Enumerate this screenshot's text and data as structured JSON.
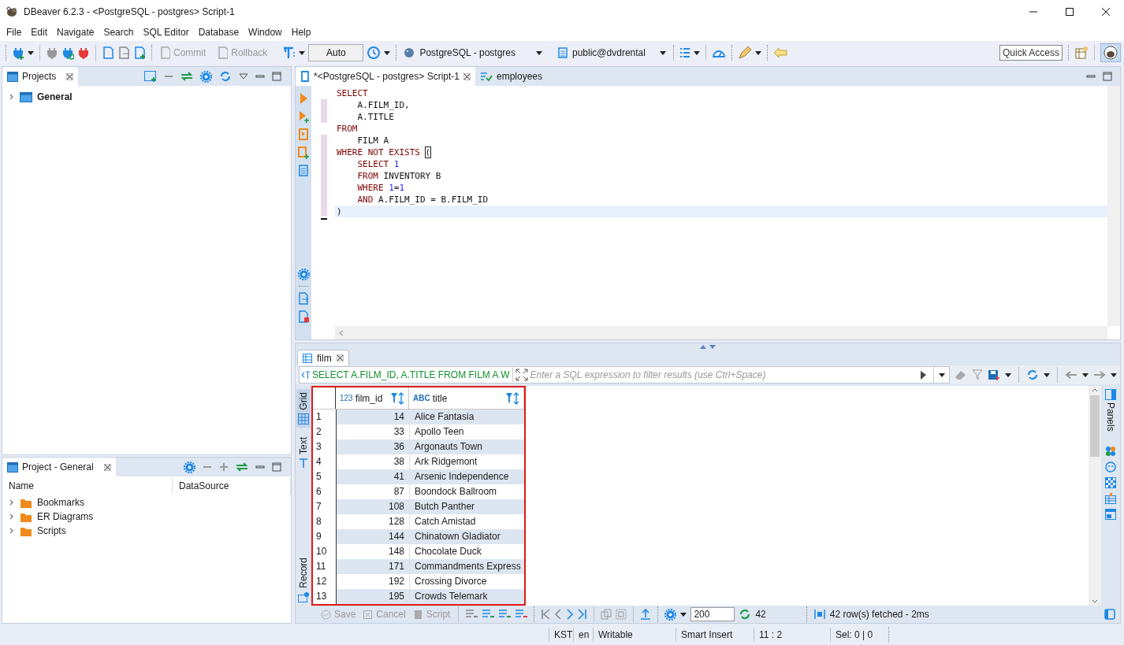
{
  "window": {
    "title": "DBeaver 6.2.3 - <PostgreSQL - postgres> Script-1"
  },
  "menu": [
    "File",
    "Edit",
    "Navigate",
    "Search",
    "SQL Editor",
    "Database",
    "Window",
    "Help"
  ],
  "toolbar": {
    "commit": {
      "label": "Commit",
      "disabled": true
    },
    "rollback": {
      "label": "Rollback",
      "disabled": true
    },
    "transaction_mode": "Auto",
    "datasource": "PostgreSQL - postgres",
    "schema": "public@dvdrental",
    "quick_access": "Quick Access"
  },
  "projects_panel": {
    "title": "Projects",
    "tree": [
      {
        "label": "General",
        "expanded": false
      }
    ]
  },
  "project_panel": {
    "title": "Project - General",
    "columns": [
      "Name",
      "DataSource"
    ],
    "tree": [
      {
        "label": "Bookmarks",
        "expanded": false
      },
      {
        "label": "ER Diagrams",
        "expanded": false
      },
      {
        "label": "Scripts",
        "expanded": false
      }
    ]
  },
  "editor": {
    "tabs": [
      {
        "label": "*<PostgreSQL - postgres> Script-1",
        "selected": true
      },
      {
        "label": "employees",
        "selected": false
      }
    ],
    "lines": [
      {
        "current": false,
        "tokens": [
          {
            "kind": "keyword",
            "text": "SELECT"
          }
        ]
      },
      {
        "current": false,
        "tokens": [
          {
            "kind": "plain",
            "text": "    A.FILM_ID,"
          }
        ]
      },
      {
        "current": false,
        "tokens": [
          {
            "kind": "plain",
            "text": "    A.TITLE"
          }
        ]
      },
      {
        "current": false,
        "tokens": [
          {
            "kind": "keyword",
            "text": "FROM"
          }
        ]
      },
      {
        "current": false,
        "tokens": [
          {
            "kind": "plain",
            "text": "    FILM A"
          }
        ]
      },
      {
        "current": false,
        "tokens": [
          {
            "kind": "keyword",
            "text": "WHERE NOT EXISTS "
          },
          {
            "kind": "bracket",
            "text": "("
          }
        ]
      },
      {
        "current": false,
        "tokens": [
          {
            "kind": "keyword",
            "text": "    SELECT "
          },
          {
            "kind": "number",
            "text": "1"
          }
        ]
      },
      {
        "current": false,
        "tokens": [
          {
            "kind": "keyword",
            "text": "    FROM "
          },
          {
            "kind": "plain",
            "text": "INVENTORY B"
          }
        ]
      },
      {
        "current": false,
        "tokens": [
          {
            "kind": "keyword",
            "text": "    WHERE "
          },
          {
            "kind": "number",
            "text": "1"
          },
          {
            "kind": "plain",
            "text": "="
          },
          {
            "kind": "number",
            "text": "1"
          }
        ]
      },
      {
        "current": false,
        "tokens": [
          {
            "kind": "keyword",
            "text": "    AND "
          },
          {
            "kind": "plain",
            "text": "A.FILM_ID = B.FILM_ID"
          }
        ]
      },
      {
        "current": true,
        "tokens": [
          {
            "kind": "plain",
            "text": ")"
          }
        ]
      }
    ]
  },
  "results": {
    "tab": "film",
    "query": "SELECT A.FILM_ID, A.TITLE FROM FILM A W",
    "filter_placeholder": "Enter a SQL expression to filter results (use Ctrl+Space)",
    "side_tabs": [
      {
        "label": "Grid",
        "selected": true
      },
      {
        "label": "Text",
        "selected": false
      },
      {
        "label": "Record",
        "selected": false
      }
    ],
    "columns": [
      {
        "type_label": "123",
        "name": "film_id",
        "kind": "number"
      },
      {
        "type_label": "ABC",
        "name": "title",
        "kind": "text"
      }
    ],
    "rows": [
      {
        "number": "1",
        "cells": [
          "14",
          "Alice Fantasia"
        ]
      },
      {
        "number": "2",
        "cells": [
          "33",
          "Apollo Teen"
        ]
      },
      {
        "number": "3",
        "cells": [
          "36",
          "Argonauts Town"
        ]
      },
      {
        "number": "4",
        "cells": [
          "38",
          "Ark Ridgemont"
        ]
      },
      {
        "number": "5",
        "cells": [
          "41",
          "Arsenic Independence"
        ]
      },
      {
        "number": "6",
        "cells": [
          "87",
          "Boondock Ballroom"
        ]
      },
      {
        "number": "7",
        "cells": [
          "108",
          "Butch Panther"
        ]
      },
      {
        "number": "8",
        "cells": [
          "128",
          "Catch Amistad"
        ]
      },
      {
        "number": "9",
        "cells": [
          "144",
          "Chinatown Gladiator"
        ]
      },
      {
        "number": "10",
        "cells": [
          "148",
          "Chocolate Duck"
        ]
      },
      {
        "number": "11",
        "cells": [
          "171",
          "Commandments Express"
        ]
      },
      {
        "number": "12",
        "cells": [
          "192",
          "Crossing Divorce"
        ]
      },
      {
        "number": "13",
        "cells": [
          "195",
          "Crowds Telemark"
        ]
      }
    ],
    "panels_label": "Panels",
    "footer": {
      "buttons": [
        {
          "label": "Save",
          "disabled": true
        },
        {
          "label": "Cancel",
          "disabled": true
        },
        {
          "label": "Script",
          "disabled": true
        }
      ],
      "fetch_size": "200",
      "count": "42",
      "status": "42 row(s) fetched - 2ms"
    }
  },
  "status_bar": [
    "KST",
    "en",
    "Writable",
    "Smart Insert",
    "11 : 2",
    "Sel: 0 | 0"
  ]
}
